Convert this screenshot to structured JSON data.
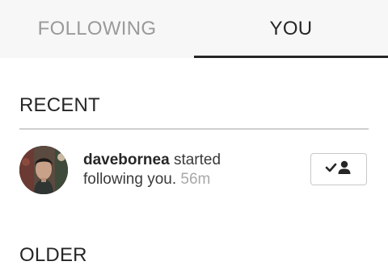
{
  "tabs": {
    "following_label": "FOLLOWING",
    "you_label": "YOU",
    "active": "YOU"
  },
  "sections": {
    "recent_title": "RECENT",
    "older_title": "OLDER"
  },
  "activity": {
    "username": "davebornea",
    "action_part1": "started",
    "action_part2": "following you.",
    "time": "56m",
    "button_icon": "checkmark-person-icon"
  },
  "colors": {
    "active_tab": "#262626",
    "inactive_tab": "#9a9a9a",
    "timestamp": "#a8a8a8",
    "divider": "#cfcfcf"
  }
}
